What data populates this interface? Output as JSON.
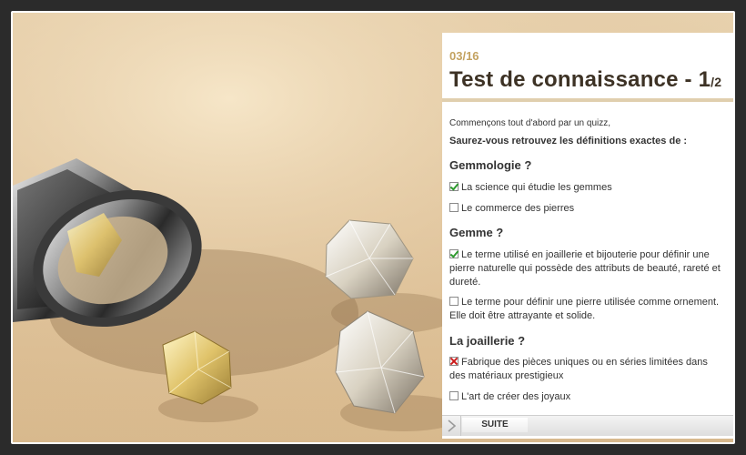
{
  "slide": {
    "counter": "03/16"
  },
  "header": {
    "title": "Test de connaissance - 1",
    "title_fraction": "/2"
  },
  "intro": {
    "text": "Commençons tout d'abord par un quizz,",
    "prompt": "Saurez-vous retrouvez les définitions exactes de :"
  },
  "questions": [
    {
      "title": "Gemmologie ?",
      "options": [
        {
          "label": "La science qui étudie les gemmes",
          "state": "correct-checked"
        },
        {
          "label": "Le commerce des pierres",
          "state": "unchecked"
        }
      ]
    },
    {
      "title": "Gemme ?",
      "options": [
        {
          "label": "Le terme utilisé en joaillerie et bijouterie pour définir une pierre naturelle qui possède des attributs de beauté, rareté et dureté.",
          "state": "correct-checked"
        },
        {
          "label": "Le terme pour définir une pierre utilisée comme ornement. Elle doit être attrayante et solide.",
          "state": "unchecked"
        }
      ]
    },
    {
      "title": "La joaillerie ?",
      "options": [
        {
          "label": "Fabrique des pièces uniques ou en séries limitées dans des matériaux prestigieux",
          "state": "wrong-checked"
        },
        {
          "label": "L'art de créer des joyaux",
          "state": "unchecked"
        }
      ]
    }
  ],
  "navigation": {
    "next_label": "SUITE",
    "arrow_icon": "chevron-right-icon"
  },
  "colors": {
    "accent_gold": "#c3a260",
    "title_brown": "#3d3225",
    "rule_beige": "#e0cfae",
    "check_green": "#2e9a2e",
    "check_red": "#cc1b1b"
  }
}
